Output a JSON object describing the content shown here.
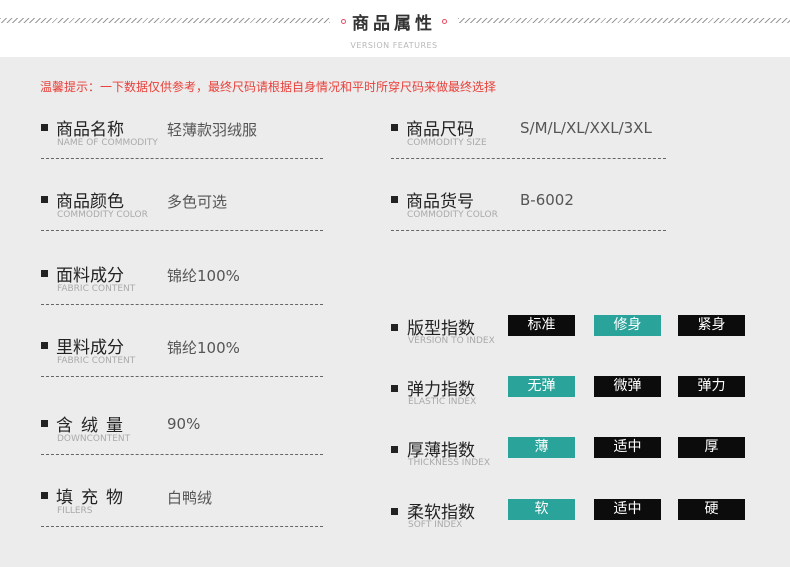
{
  "header": {
    "title": "商品属性",
    "subtitle": "VERSION FEATURES",
    "accent_color": "#e84a5f"
  },
  "notice": "温馨提示：一下数据仅供参考，最终尺码请根据自身情况和平时所穿尺码来做最终选择",
  "left_attributes": [
    {
      "label": "商品名称",
      "sub": "NAME OF COMMODITY",
      "value": "轻薄款羽绒服"
    },
    {
      "label": "商品颜色",
      "sub": "COMMODITY COLOR",
      "value": "多色可选"
    },
    {
      "label": "面料成分",
      "sub": "FABRIC CONTENT",
      "value": "锦纶100%"
    },
    {
      "label": "里料成分",
      "sub": "FABRIC CONTENT",
      "value": "锦纶100%"
    },
    {
      "label": "含绒量",
      "sub": "DOWNCONTENT",
      "value": "90%"
    },
    {
      "label": "填充物",
      "sub": "FILLERS",
      "value": "白鸭绒"
    }
  ],
  "right_attributes": [
    {
      "label": "商品尺码",
      "sub": "COMMODITY SIZE",
      "value": "S/M/L/XL/XXL/3XL"
    },
    {
      "label": "商品货号",
      "sub": "COMMODITY COLOR",
      "value": "B-6002"
    }
  ],
  "indices": [
    {
      "label": "版型指数",
      "sub": "VERSION TO INDEX",
      "options": [
        "标准",
        "修身",
        "紧身"
      ],
      "selected": 1
    },
    {
      "label": "弹力指数",
      "sub": "ELASTIC INDEX",
      "options": [
        "无弹",
        "微弹",
        "弹力"
      ],
      "selected": 0
    },
    {
      "label": "厚薄指数",
      "sub": "THICKNESS INDEX",
      "options": [
        "薄",
        "适中",
        "厚"
      ],
      "selected": 0
    },
    {
      "label": "柔软指数",
      "sub": "SOFT INDEX",
      "options": [
        "软",
        "适中",
        "硬"
      ],
      "selected": 0
    }
  ],
  "colors": {
    "selected": "#2aa39b",
    "unselected": "#0c0c0c",
    "notice": "#e8403a"
  }
}
